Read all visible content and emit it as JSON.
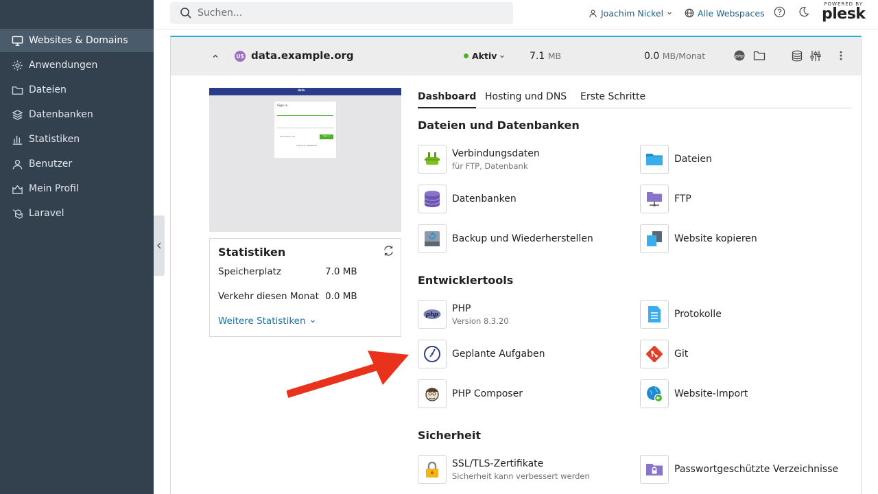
{
  "sidebar": {
    "items": [
      {
        "label": "Websites & Domains",
        "icon": "monitor-icon",
        "active": true
      },
      {
        "label": "Anwendungen",
        "icon": "gear-icon"
      },
      {
        "label": "Dateien",
        "icon": "folder-icon"
      },
      {
        "label": "Datenbanken",
        "icon": "layers-icon"
      },
      {
        "label": "Statistiken",
        "icon": "bar-chart-icon"
      },
      {
        "label": "Benutzer",
        "icon": "user-icon"
      },
      {
        "label": "Mein Profil",
        "icon": "profile-icon"
      },
      {
        "label": "Laravel",
        "icon": "laravel-icon"
      }
    ]
  },
  "header": {
    "search_placeholder": "Suchen...",
    "user_name": "Joachim Nickel",
    "webspaces": "Alle Webspaces",
    "logo_small": "POWERED BY",
    "logo_big": "plesk"
  },
  "domain": {
    "badge": "US",
    "name": "data.example.org",
    "status": "Aktiv",
    "disk_value": "7.1",
    "disk_unit": "MB",
    "traffic_value": "0.0",
    "traffic_unit": "MB/Monat",
    "accent_color": "#28aade",
    "status_color": "#4caf2a"
  },
  "preview": {
    "brand": "data",
    "sign_in": "Sign in",
    "remember": "Remember Me",
    "button": "Sign in",
    "forgot": "Lost your password?"
  },
  "stats": {
    "title": "Statistiken",
    "disk_label": "Speicherplatz",
    "disk_value": "7.0 MB",
    "traffic_label": "Verkehr diesen Monat",
    "traffic_value": "0.0 MB",
    "more_link": "Weitere Statistiken"
  },
  "tabs": [
    {
      "label": "Dashboard",
      "active": true
    },
    {
      "label": "Hosting und DNS"
    },
    {
      "label": "Erste Schritte"
    }
  ],
  "sections": {
    "files": {
      "title": "Dateien und Datenbanken",
      "tools": [
        {
          "name": "Verbindungsdaten",
          "sub": "für FTP, Datenbank",
          "icon": "plug-icon"
        },
        {
          "name": "Dateien",
          "icon": "folder-icon"
        },
        {
          "name": "Datenbanken",
          "icon": "database-icon"
        },
        {
          "name": "FTP",
          "icon": "ftp-folder-icon"
        },
        {
          "name": "Backup und Wiederherstellen",
          "icon": "backup-icon"
        },
        {
          "name": "Website kopieren",
          "icon": "copy-icon"
        }
      ]
    },
    "dev": {
      "title": "Entwicklertools",
      "tools": [
        {
          "name": "PHP",
          "sub": "Version 8.3.20",
          "icon": "php-icon"
        },
        {
          "name": "Protokolle",
          "icon": "log-file-icon"
        },
        {
          "name": "Geplante Aufgaben",
          "icon": "clock-icon"
        },
        {
          "name": "Git",
          "icon": "git-icon"
        },
        {
          "name": "PHP Composer",
          "icon": "composer-icon"
        },
        {
          "name": "Website-Import",
          "icon": "globe-import-icon"
        }
      ]
    },
    "security": {
      "title": "Sicherheit",
      "tools": [
        {
          "name": "SSL/TLS-Zertifikate",
          "sub": "Sicherheit kann verbessert werden",
          "icon": "lock-icon"
        },
        {
          "name": "Passwortgeschützte Verzeichnisse",
          "icon": "protected-folder-icon"
        }
      ]
    }
  }
}
